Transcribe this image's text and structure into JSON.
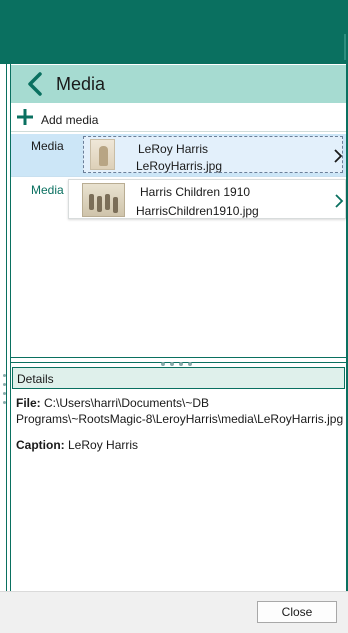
{
  "header": {
    "title": "Media",
    "back_icon": "chevron-left-icon"
  },
  "toolbar": {
    "add_label": "Add media",
    "add_icon": "plus-icon"
  },
  "media_rows": [
    {
      "label": "Media",
      "title": "LeRoy Harris",
      "filename": "LeRoyHarris.jpg"
    },
    {
      "label": "Media",
      "title": "Harris Children 1910",
      "filename": "HarrisChildren1910.jpg"
    }
  ],
  "details": {
    "header": "Details",
    "file_label": "File:",
    "file_line1": "C:\\Users\\harri\\Documents\\~DB",
    "file_line2": "Programs\\~RootsMagic-8\\LeroyHarris\\media\\LeRoyHarris.jpg",
    "caption_label": "Caption:",
    "caption_value": "LeRoy Harris"
  },
  "footer": {
    "close_label": "Close"
  },
  "colors": {
    "brand": "#0a7060",
    "header_bg": "#a6dbd1",
    "selected_row": "#cce6f7",
    "details_bg": "#dff0eb"
  }
}
